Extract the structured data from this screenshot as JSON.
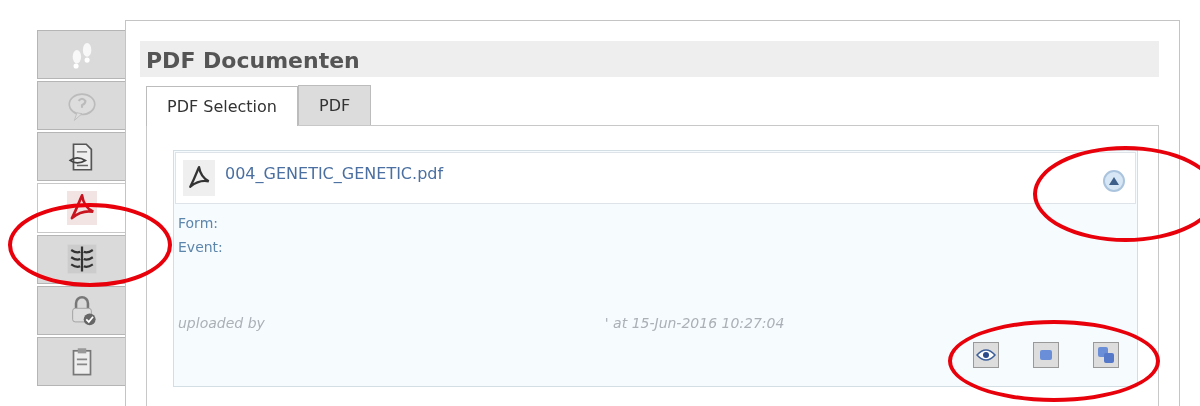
{
  "sidebar": {
    "items": [
      {
        "selected": false
      },
      {
        "selected": false
      },
      {
        "selected": false
      },
      {
        "selected": true
      },
      {
        "selected": false
      },
      {
        "selected": false
      },
      {
        "selected": false
      }
    ]
  },
  "heading": "PDF Documenten",
  "tabs": [
    {
      "label": "PDF Selection",
      "selected": true
    },
    {
      "label": "PDF",
      "selected": false
    }
  ],
  "document": {
    "file_name": "004_GENETIC_GENETIC.pdf",
    "expanded": true,
    "fields": [
      {
        "label": "Form:"
      },
      {
        "label": "Event:"
      }
    ],
    "uploaded_by": "uploaded by",
    "uploaded_at": "' at 15-Jun-2016 10:27:04"
  }
}
